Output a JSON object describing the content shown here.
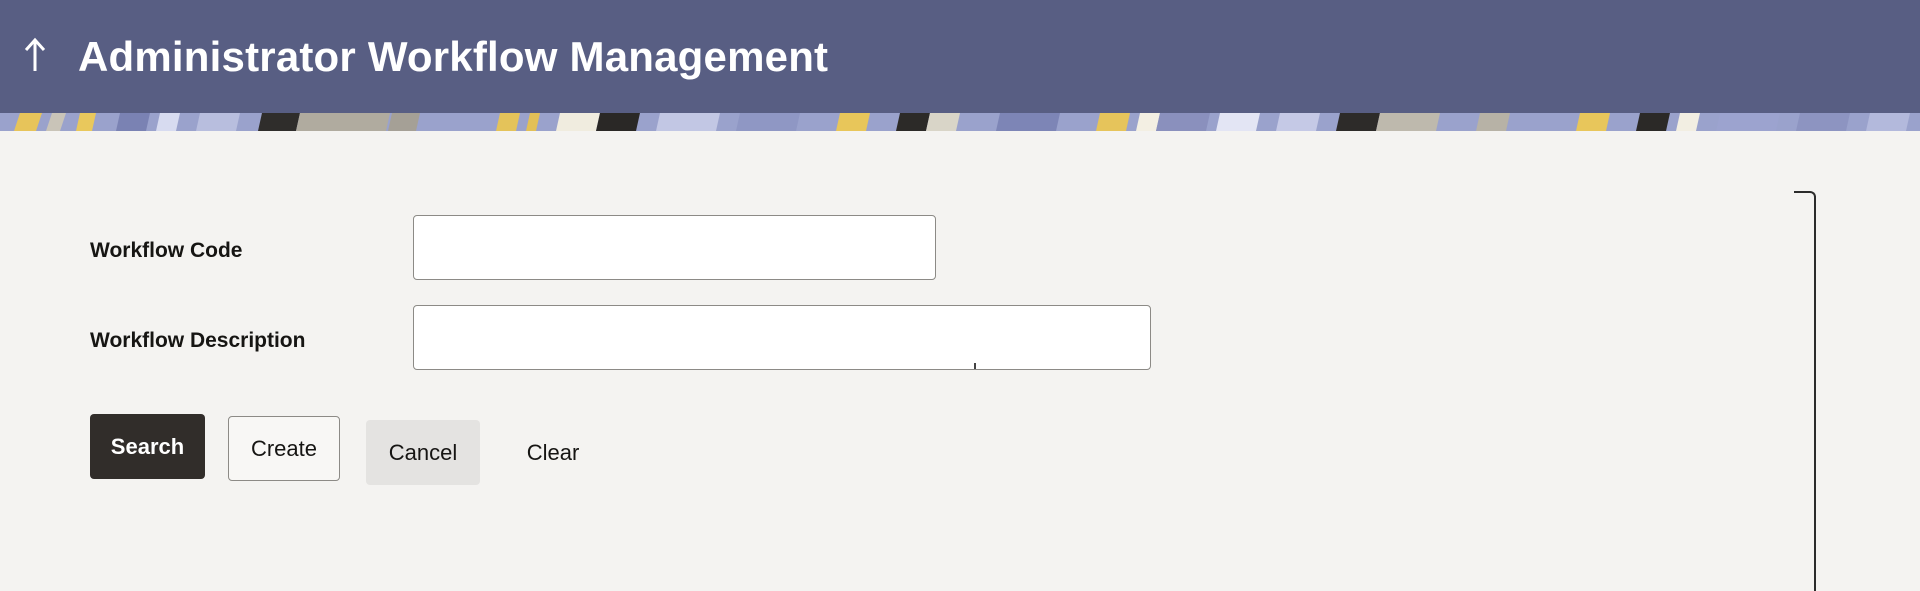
{
  "header": {
    "title": "Administrator Workflow Management",
    "back_icon": "up-arrow-icon",
    "background_color": "#585e83"
  },
  "form": {
    "workflow_code": {
      "label": "Workflow Code",
      "value": "",
      "placeholder": ""
    },
    "workflow_description": {
      "label": "Workflow Description",
      "value": "",
      "placeholder": ""
    }
  },
  "actions": {
    "search_label": "Search",
    "create_label": "Create",
    "cancel_label": "Cancel",
    "clear_label": "Clear"
  },
  "colors": {
    "primary_button": "#312d2a",
    "page_background": "#f4f3f1"
  }
}
